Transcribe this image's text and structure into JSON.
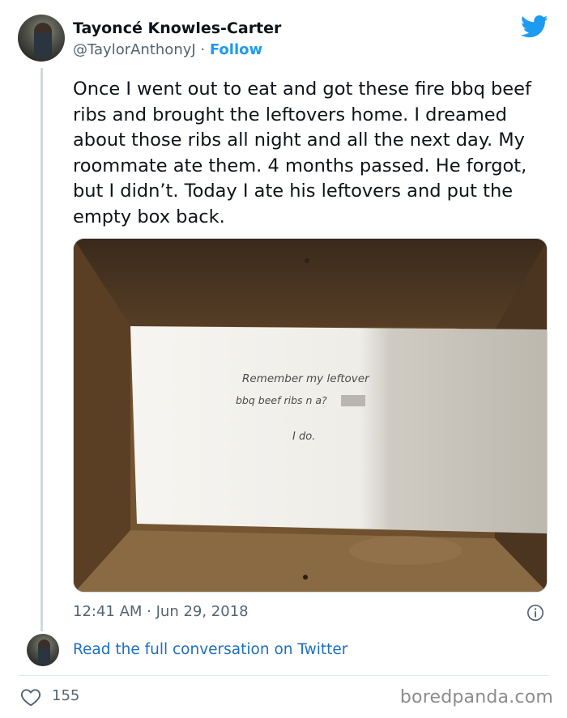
{
  "author": {
    "name": "Tayoncé Knowles-Carter",
    "handle": "@TaylorAnthonyJ",
    "separator": " · ",
    "follow_label": "Follow"
  },
  "icons": {
    "brand": "twitter-bird-icon",
    "info": "info-icon",
    "like": "heart-icon"
  },
  "colors": {
    "accent": "#1d9bf0",
    "link": "#1d6fc1",
    "secondary_text": "#536471"
  },
  "tweet": {
    "text": "Once I went out to eat and got these fire bbq beef ribs and brought the leftovers home. I dreamed about those ribs all night and all the next day. My roommate ate them. 4 months passed. He forgot, but I didn’t. Today I ate his leftovers and put the empty box back.",
    "photo_note": {
      "line1": "Remember my leftover",
      "line2": "bbq beef ribs n    a?",
      "line3": "I do."
    },
    "timestamp": "12:41 AM · Jun 29, 2018"
  },
  "footer": {
    "conversation_link": "Read the full conversation on Twitter",
    "like_count": "155"
  },
  "watermark": "boredpanda.com"
}
